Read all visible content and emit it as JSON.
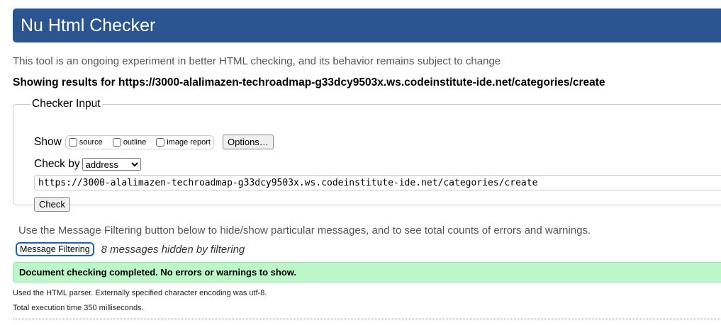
{
  "header": {
    "title": "Nu Html Checker"
  },
  "intro": "This tool is an ongoing experiment in better HTML checking, and its behavior remains subject to change",
  "results_heading": "Showing results for https://3000-alalimazen-techroadmap-g33dcy9503x.ws.codeinstitute-ide.net/categories/create",
  "checker_input": {
    "legend": "Checker Input",
    "show_label": "Show",
    "show_options": [
      {
        "label": "source",
        "checked": false
      },
      {
        "label": "outline",
        "checked": false
      },
      {
        "label": "image report",
        "checked": false
      }
    ],
    "options_button": "Options…",
    "check_by_label": "Check by",
    "check_by_value": "address",
    "url_value": "https://3000-alalimazen-techroadmap-g33dcy9503x.ws.codeinstitute-ide.net/categories/create",
    "check_button": "Check"
  },
  "filtering": {
    "text": "Use the Message Filtering button below to hide/show particular messages, and to see total counts of errors and warnings.",
    "button": "Message Filtering",
    "hidden_count_text": "8 messages hidden by filtering"
  },
  "success": "Document checking completed. No errors or warnings to show.",
  "details": [
    "Used the HTML parser. Externally specified character encoding was utf-8.",
    "Total execution time 350 milliseconds."
  ]
}
